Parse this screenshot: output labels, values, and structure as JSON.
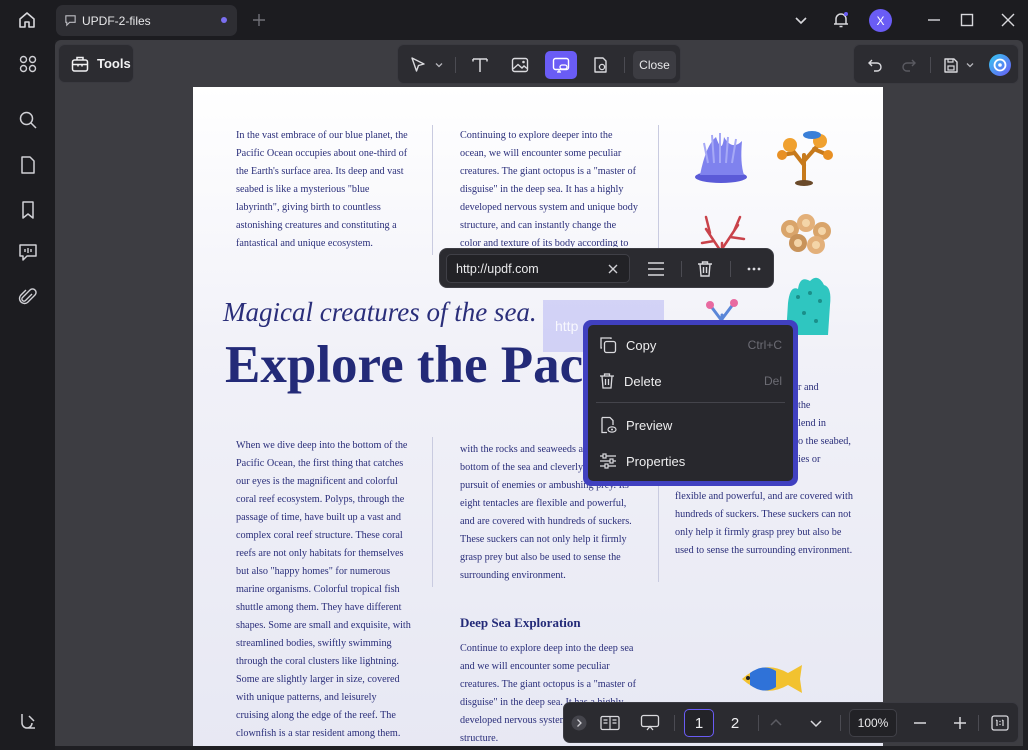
{
  "tab": {
    "title": "UPDF-2-files"
  },
  "user": {
    "initial": "X"
  },
  "tools": {
    "label": "Tools"
  },
  "toolbar": {
    "close_label": "Close"
  },
  "page": {
    "top_left_text": "In the vast embrace of our blue planet, the Pacific Ocean occupies about one-third of the Earth's surface area. Its deep and vast seabed is like a mysterious \"blue labyrinth\", giving birth to countless astonishing creatures and constituting a fantastical and unique ecosystem.",
    "top_mid_text": "Continuing to explore deeper into the ocean, we will encounter some peculiar creatures. The giant octopus is a \"master of disguise\" in the deep sea. It has a highly developed nervous system and unique body structure, and can instantly change the color and texture of its body according to",
    "subtitle": "Magical creatures of the sea.",
    "headline": "Explore the Pac",
    "link_box_text": "http",
    "bottom_left_text": "When we dive deep into the bottom of the Pacific Ocean, the first thing that catches our eyes is the magnificent and colorful coral reef ecosystem. Polyps, through the passage of time, have built up a vast and complex coral reef structure. These coral reefs are not only habitats for themselves but also \"happy homes\" for numerous marine organisms. Colorful tropical fish shuttle among them. They have different shapes. Some are small and exquisite, with streamlined bodies, swiftly swimming through the coral clusters like lightning. Some are slightly larger in size, covered with unique patterns, and leisurely cruising along the edge of the reef. The clownfish is a star resident among them. They have",
    "bottom_mid_text": "with the rocks and seaweeds around the bottom of the sea and cleverly avoiding the pursuit of enemies or ambushing prey. Its eight tentacles are flexible and powerful, and are covered with hundreds of suckers. These suckers can not only help it firmly grasp prey but also be used to sense the surrounding environment.",
    "right_col_lines": [
      "r and",
      "the",
      "lend in",
      "o the seabed,",
      "ies or"
    ],
    "right_col_text": "flexible and powerful, and are covered with hundreds of suckers. These suckers can not only help it firmly grasp prey but also be used to sense the surrounding environment.",
    "section_heading": "Deep Sea Exploration",
    "section_text": "Continue to explore deep into the deep sea and we will encounter some peculiar creatures. The giant octopus is a \"master of disguise\" in the deep sea. It has a highly developed nervous system and unique body structure."
  },
  "link_popup": {
    "url": "http://updf.com"
  },
  "context_menu": {
    "items": [
      {
        "label": "Copy",
        "shortcut": "Ctrl+C"
      },
      {
        "label": "Delete",
        "shortcut": "Del"
      },
      {
        "label": "Preview",
        "shortcut": ""
      },
      {
        "label": "Properties",
        "shortcut": ""
      }
    ]
  },
  "bottom_bar": {
    "pages": [
      "1",
      "2"
    ],
    "zoom": "100%"
  },
  "colors": {
    "accent": "#6a5cf5",
    "menu_border": "#4040c0",
    "text_blue": "#2a2e7a"
  }
}
